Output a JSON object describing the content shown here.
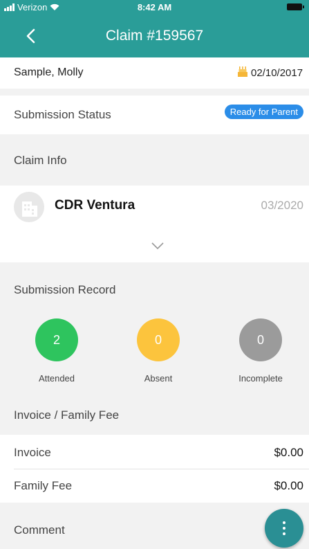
{
  "status_bar": {
    "carrier": "Verizon",
    "time": "8:42 AM"
  },
  "header": {
    "title": "Claim #159567"
  },
  "child": {
    "name": "Sample, Molly",
    "birthdate": "02/10/2017"
  },
  "submission_status": {
    "label": "Submission Status",
    "badge": "Ready for Parent"
  },
  "claim_info": {
    "section_label": "Claim Info",
    "provider": "CDR Ventura",
    "period": "03/2020"
  },
  "submission_record": {
    "section_label": "Submission Record",
    "items": [
      {
        "value": "2",
        "label": "Attended",
        "color": "#2ec45e"
      },
      {
        "value": "0",
        "label": "Absent",
        "color": "#fcc43d"
      },
      {
        "value": "0",
        "label": "Incomplete",
        "color": "#9b9b9b"
      }
    ]
  },
  "invoice": {
    "section_label": "Invoice / Family Fee",
    "rows": [
      {
        "label": "Invoice",
        "value": "$0.00"
      },
      {
        "label": "Family Fee",
        "value": "$0.00"
      }
    ]
  },
  "comment": {
    "section_label": "Comment"
  },
  "colors": {
    "brand": "#2a9d98",
    "badge": "#2b8de8",
    "birthday_icon": "#f5b638"
  }
}
